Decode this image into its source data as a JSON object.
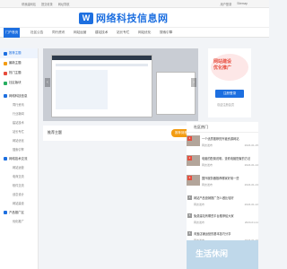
{
  "topbar": {
    "left": [
      "帮我建网站",
      "提交收录",
      "网址导航"
    ],
    "right": [
      "用户登录",
      "Sitemap"
    ]
  },
  "logo": {
    "mark": "W",
    "text": "网络科技信息网"
  },
  "nav": [
    {
      "label": "门户首页",
      "active": true
    },
    {
      "label": "社区公告",
      "active": false
    },
    {
      "label": "同行资讯",
      "active": false
    },
    {
      "label": "网站运营",
      "active": false
    },
    {
      "label": "建站技术",
      "active": false
    },
    {
      "label": "站长专栏",
      "active": false
    },
    {
      "label": "网站优化",
      "active": false
    },
    {
      "label": "搜索引擎",
      "active": false
    }
  ],
  "sidebar": {
    "top": [
      {
        "label": "推荐主题",
        "icon": "star-icon"
      },
      {
        "label": "最新主题",
        "icon": "clock-icon"
      },
      {
        "label": "热门主题",
        "icon": "fire-icon"
      },
      {
        "label": "社区版块",
        "icon": "grid-icon"
      }
    ],
    "group1": {
      "label": "网络科技信息",
      "subs": [
        "同行资讯",
        "行业新闻",
        "建站技术",
        "站长专栏",
        "网站优化",
        "搜索引擎"
      ]
    },
    "group2": {
      "label": "网络技术交流",
      "subs": [
        "网站运营",
        "电商交流",
        "软件交流",
        "创意设计",
        "网站建设"
      ]
    },
    "group3": {
      "label": "产品推广区",
      "subs": [
        "优化推广"
      ]
    }
  },
  "recommend": {
    "title": "推荐主题",
    "button": "推荐到首页"
  },
  "right_card": {
    "text_line1": "网站建设",
    "text_line2": "优化推广",
    "button": "注册登录",
    "sub": "欢迎注册会员"
  },
  "rlist": {
    "title": "社区热门",
    "items": [
      {
        "num": "1",
        "text": "一个优质推荐的外链资源网站",
        "author": "网友发布",
        "date": "2024-01-15"
      },
      {
        "num": "2",
        "text": "电脑的配置说明，查看电脑配置的方法",
        "author": "网友发布",
        "date": "2024-01-14"
      },
      {
        "num": "3",
        "text": "国外服务器推荐哪家好用一些",
        "author": "网友发布",
        "date": "2024-01-13"
      },
      {
        "num": "4",
        "text": "网站产品营销推广怎么做比较好",
        "author": "网友发布",
        "date": "2024-01-12"
      },
      {
        "num": "5",
        "text": "免费建站有哪些平台推荐给大家",
        "author": "网友发布",
        "date": "2024-01-11"
      },
      {
        "num": "6",
        "text": "淘宝店铺运营的基本技巧分享",
        "author": "网友发布",
        "date": "2024-01-10"
      }
    ]
  },
  "ad": {
    "text": "生活休闲"
  },
  "colors": {
    "brand": "#1d6fe0",
    "accent": "#f39c12",
    "hot": "#e74c3c"
  }
}
